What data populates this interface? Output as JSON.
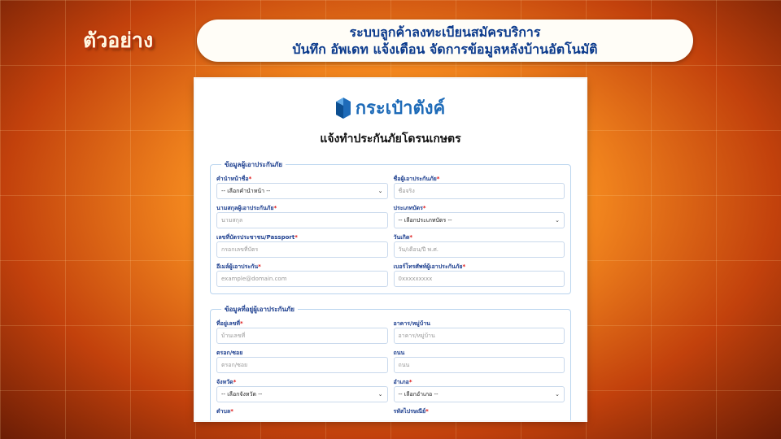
{
  "header": {
    "badge": "ตัวอย่าง",
    "banner_line1": "ระบบลูกค้าลงทะเบียนสมัครบริการ",
    "banner_line2": "บันทึก อัพเดท แจ้งเตือน จัดการข้อมูลหลังบ้านอัตโนมัติ"
  },
  "form": {
    "logo_text": "กระเป๋าตังค์",
    "title": "แจ้งทำประกันภัยโดรนเกษตร",
    "section1": {
      "legend": "ข้อมูลผู้เอาประกันภัย",
      "fields": {
        "prefix": {
          "label": "คำนำหน้าชื่อ",
          "value": "-- เลือกคำนำหน้า --"
        },
        "firstname": {
          "label": "ชื่อผู้เอาประกันภัย",
          "placeholder": "ชื่อจริง"
        },
        "lastname": {
          "label": "นามสกุลผู้เอาประกันภัย",
          "placeholder": "นามสกุล"
        },
        "cardtype": {
          "label": "ประเภทบัตร",
          "value": "-- เลือกประเภทบัตร --"
        },
        "idnumber": {
          "label": "เลขที่บัตรประชาชน/Passport",
          "placeholder": "กรอกเลขที่บัตร"
        },
        "birthdate": {
          "label": "วันเกิด",
          "placeholder": "วัน/เดือน/ปี พ.ศ."
        },
        "email": {
          "label": "อีเมล์ผู้เอาประกัน",
          "placeholder": "example@domain.com"
        },
        "phone": {
          "label": "เบอร์โทรศัพท์ผู้เอาประกันภัย",
          "placeholder": "0xxxxxxxxx"
        }
      }
    },
    "section2": {
      "legend": "ข้อมูลที่อยู่ผู้เอาประกันภัย",
      "fields": {
        "houseno": {
          "label": "ที่อยู่เลขที่",
          "placeholder": "บ้านเลขที่"
        },
        "building": {
          "label": "อาคาร/หมู่บ้าน",
          "placeholder": "อาคาร/หมู่บ้าน"
        },
        "soi": {
          "label": "ตรอก/ซอย",
          "placeholder": "ตรอก/ซอย"
        },
        "road": {
          "label": "ถนน",
          "placeholder": "ถนน"
        },
        "province": {
          "label": "จังหวัด",
          "value": "-- เลือกจังหวัด --"
        },
        "district": {
          "label": "อำเภอ",
          "value": "-- เลือกอำเภอ --"
        },
        "subdistrict": {
          "label": "ตำบล"
        },
        "postcode": {
          "label": "รหัสไปรษณีย์"
        }
      }
    }
  },
  "colors": {
    "accent": "#1e6bb8",
    "label": "#1d3f8f",
    "required": "#dd1111"
  }
}
